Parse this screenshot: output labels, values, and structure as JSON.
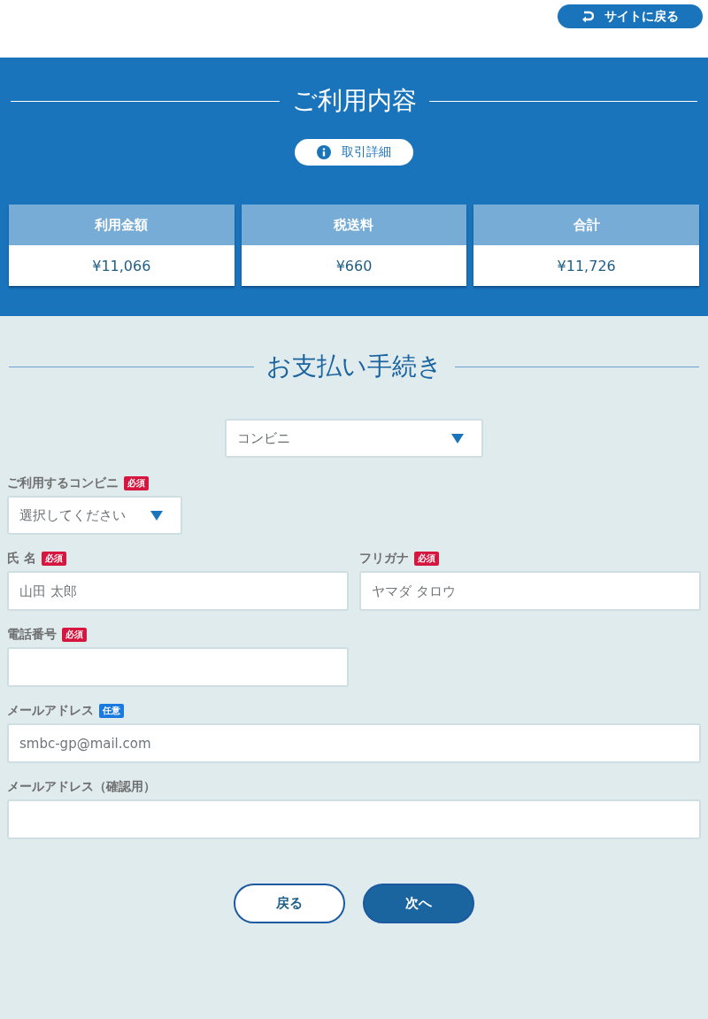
{
  "top_bar": {
    "back_to_site": "サイトに戻る"
  },
  "summary": {
    "title": "ご利用内容",
    "details_button": "取引詳細",
    "cards": [
      {
        "label": "利用金額",
        "value": "¥11,066"
      },
      {
        "label": "税送料",
        "value": "¥660"
      },
      {
        "label": "合計",
        "value": "¥11,726"
      }
    ]
  },
  "payment": {
    "title": "お支払い手続き",
    "method_select": {
      "value": "コンビニ"
    },
    "store": {
      "label": "ご利用するコンビニ",
      "badge": {
        "text": "必須",
        "kind": "required"
      },
      "value": "選択してください"
    },
    "fields": [
      {
        "label": "氏 名",
        "badge": {
          "text": "必須",
          "kind": "required"
        },
        "placeholder": "山田 太郎",
        "kind": "short"
      },
      {
        "label": "フリガナ",
        "badge": {
          "text": "必須",
          "kind": "required"
        },
        "placeholder": "ヤマダ タロウ",
        "kind": "short"
      },
      {
        "label": "電話番号",
        "badge": {
          "text": "必須",
          "kind": "required"
        },
        "kind": "short"
      },
      {
        "label": "メールアドレス",
        "badge": {
          "text": "任意",
          "kind": "optional"
        },
        "placeholder": "smbc-gp@mail.com",
        "kind": "long"
      },
      {
        "label": "メールアドレス（確認用）",
        "kind": "long"
      }
    ]
  },
  "buttons": {
    "back": "戻る",
    "next": "次へ"
  }
}
